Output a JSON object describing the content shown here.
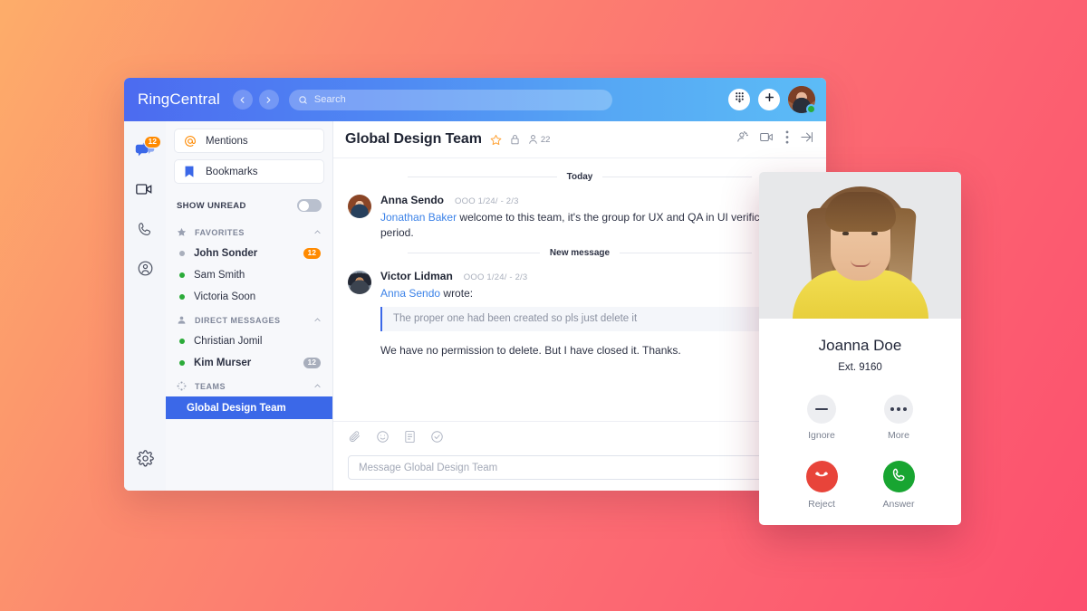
{
  "topbar": {
    "brand": "RingCentral",
    "back_icon": "chevron-left-icon",
    "forward_icon": "chevron-right-icon",
    "search_icon": "search-icon",
    "search_placeholder": "Search",
    "search_value": "",
    "dialpad_icon": "dialpad-icon",
    "add_icon": "plus-icon",
    "avatar_icon": "user-avatar",
    "presence": "available",
    "gradient_from": "#4C6BF0",
    "gradient_to": "#5CBCF6"
  },
  "rail": {
    "items": [
      {
        "name": "messages",
        "icon": "message-bubble-icon",
        "badge": "12",
        "active": true
      },
      {
        "name": "video",
        "icon": "video-camera-icon",
        "badge": "",
        "active": false
      },
      {
        "name": "phone",
        "icon": "phone-icon",
        "badge": "",
        "active": false
      },
      {
        "name": "contacts",
        "icon": "contacts-icon",
        "badge": "",
        "active": false
      }
    ],
    "settings": {
      "name": "settings",
      "icon": "gear-icon"
    },
    "badge_color": "#FF8A00"
  },
  "sidebar": {
    "mentions": {
      "label": "Mentions",
      "icon": "at-sign-icon",
      "color": "#FF8A00"
    },
    "bookmarks": {
      "label": "Bookmarks",
      "icon": "bookmark-icon",
      "color": "#3B68E8"
    },
    "show_unread": {
      "label": "SHOW UNREAD",
      "enabled": false
    },
    "sections": [
      {
        "title": "FAVORITES",
        "icon": "star-icon",
        "chevron": "chevron-up-icon",
        "items": [
          {
            "name": "John Sonder",
            "presence": "offline",
            "badge": "12",
            "badge_style": "orange",
            "unread": true
          },
          {
            "name": "Sam Smith",
            "presence": "online",
            "badge": "",
            "badge_style": "",
            "unread": false
          },
          {
            "name": "Victoria Soon",
            "presence": "online",
            "badge": "",
            "badge_style": "",
            "unread": false
          }
        ]
      },
      {
        "title": "DIRECT MESSAGES",
        "icon": "person-icon",
        "chevron": "chevron-up-icon",
        "items": [
          {
            "name": "Christian Jomil",
            "presence": "online",
            "badge": "",
            "badge_style": "",
            "unread": false
          },
          {
            "name": "Kim Murser",
            "presence": "online",
            "badge": "12",
            "badge_style": "grey",
            "unread": true
          }
        ]
      },
      {
        "title": "TEAMS",
        "icon": "teams-icon",
        "chevron": "chevron-up-icon",
        "items": [
          {
            "name": "Global Design Team",
            "presence": "",
            "badge": "",
            "badge_style": "",
            "unread": false,
            "active": true
          }
        ]
      }
    ]
  },
  "conversation": {
    "title": "Global Design Team",
    "favorite_icon": "star-icon",
    "lock_icon": "lock-icon",
    "members_icon": "people-icon",
    "members_count": "22",
    "actions": [
      {
        "name": "add-person",
        "icon": "add-person-icon"
      },
      {
        "name": "start-video",
        "icon": "video-camera-icon"
      },
      {
        "name": "more-options",
        "icon": "more-vertical-icon"
      },
      {
        "name": "collapse-panel",
        "icon": "arrow-to-right-icon"
      }
    ],
    "dividers": {
      "today": "Today",
      "new_message": "New message"
    },
    "messages": [
      {
        "author": "Anna Sendo",
        "avatar": "anna-avatar",
        "time": "OOO 1/24/ - 2/3",
        "mention": "Jonathan Baker",
        "text": " welcome to this team, it's the group for UX and QA in UI verification period.",
        "quote": null,
        "after_quote": null
      },
      {
        "author": "Victor Lidman",
        "avatar": "victor-avatar",
        "time": "OOO 1/24/ - 2/3",
        "mention": "Anna Sendo",
        "text": " wrote:",
        "quote": "The proper one had been created so pls just delete it",
        "after_quote": "We have no permission to delete. But I have closed it. Thanks."
      }
    ]
  },
  "composer": {
    "tools": [
      {
        "name": "attach-file",
        "icon": "paperclip-icon"
      },
      {
        "name": "insert-emoji",
        "icon": "smiley-icon"
      },
      {
        "name": "insert-note",
        "icon": "note-icon"
      },
      {
        "name": "create-task",
        "icon": "check-circle-icon"
      }
    ],
    "placeholder": "Message Global Design Team",
    "value": ""
  },
  "call_card": {
    "photo_label": "caller-photo",
    "caller_name": "Joanna Doe",
    "extension": "Ext. 9160",
    "actions": [
      {
        "name": "ignore",
        "label": "Ignore",
        "icon": "minus-icon",
        "style": "grey"
      },
      {
        "name": "more",
        "label": "More",
        "icon": "ellipsis-icon",
        "style": "grey"
      },
      {
        "name": "reject",
        "label": "Reject",
        "icon": "phone-hangup-icon",
        "style": "red",
        "color": "#E8443A"
      },
      {
        "name": "answer",
        "label": "Answer",
        "icon": "phone-icon",
        "style": "green",
        "color": "#18A531"
      }
    ]
  }
}
